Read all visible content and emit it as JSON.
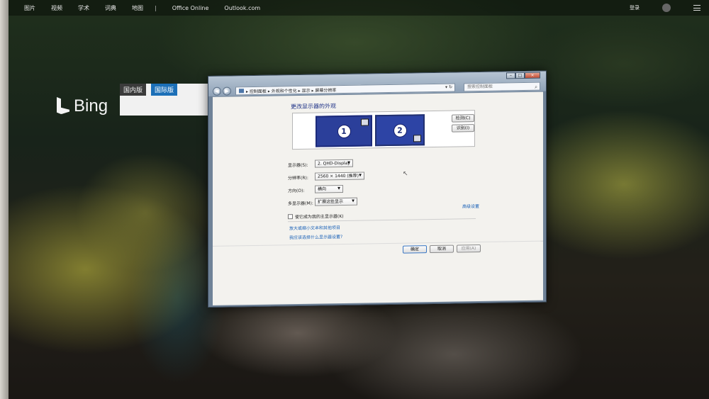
{
  "bing_nav": {
    "links": [
      "图片",
      "视频",
      "学术",
      "词典",
      "地图"
    ],
    "separator": "|",
    "office_online": "Office Online",
    "outlook": "Outlook.com",
    "signin": "登录"
  },
  "bing": {
    "logo_text": "Bing",
    "tab_cn": "国内版",
    "tab_intl": "国际版"
  },
  "window": {
    "address_path": "▸ 控制面板 ▸ 外观和个性化 ▸ 显示 ▸ 屏幕分辨率",
    "search_placeholder": "搜索控制面板",
    "page_title": "更改显示器的外观",
    "monitor_1": "1",
    "monitor_2": "2",
    "detect": "检测(C)",
    "identify": "识别(I)",
    "display_label": "显示器(S):",
    "display_value": "2. QHD-Display",
    "resolution_label": "分辨率(R):",
    "resolution_value": "2560 × 1440 (推荐)",
    "orientation_label": "方向(O):",
    "orientation_value": "横向",
    "multi_label": "多显示器(M):",
    "multi_value": "扩展这些显示",
    "main_checkbox": "使它成为我的主显示器(K)",
    "advanced": "高级设置",
    "link_text_size": "放大或缩小文本和其他项目",
    "link_which": "我应该选择什么显示器设置?",
    "ok": "确定",
    "cancel": "取消",
    "apply": "应用(A)"
  },
  "colors": {
    "bing_intl_tab": "#1c6fb7",
    "monitor_fill": "#2b3f9a",
    "link": "#1d63b8"
  }
}
